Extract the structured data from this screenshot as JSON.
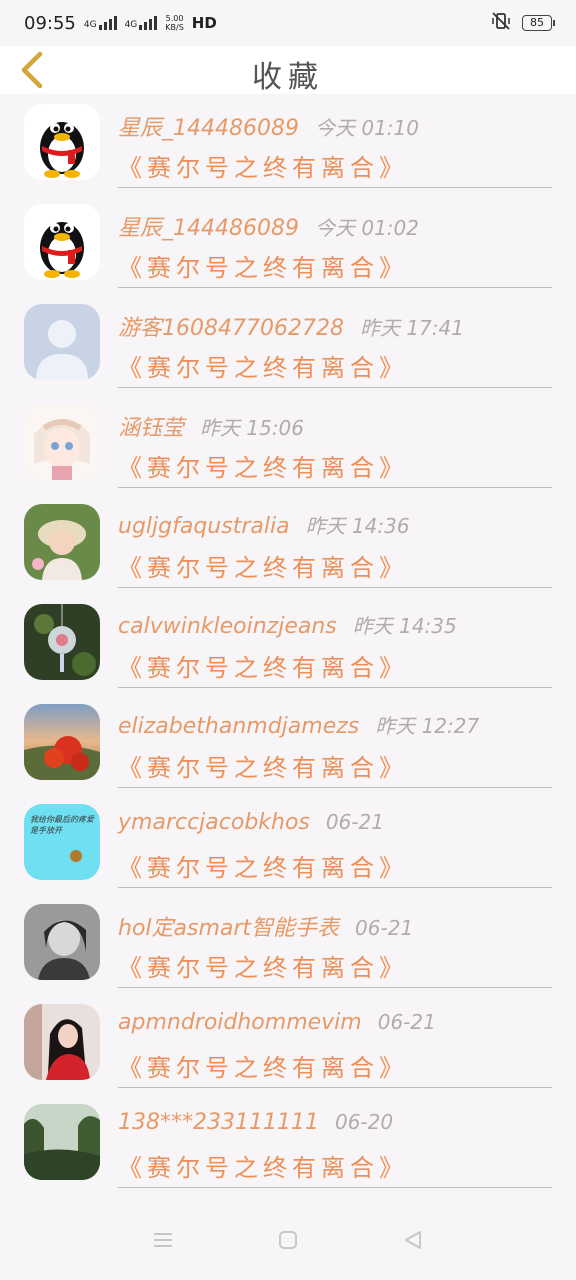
{
  "status_bar": {
    "time": "09:55",
    "net1": "4G",
    "net2": "4G",
    "speed_value": "5.00",
    "speed_unit": "KB/S",
    "hd": "HD",
    "battery": "85"
  },
  "header": {
    "title": "收藏"
  },
  "items": [
    {
      "name": "星辰_144486089",
      "time": "今天 01:10",
      "title": "《赛尔号之终有离合》"
    },
    {
      "name": "星辰_144486089",
      "time": "今天 01:02",
      "title": "《赛尔号之终有离合》"
    },
    {
      "name": "游客1608477062728",
      "time": "昨天 17:41",
      "title": "《赛尔号之终有离合》"
    },
    {
      "name": "涵钰莹",
      "time": "昨天 15:06",
      "title": "《赛尔号之终有离合》"
    },
    {
      "name": "ugljgfaqustralia",
      "time": "昨天 14:36",
      "title": "《赛尔号之终有离合》"
    },
    {
      "name": "calvwinkleoinzjeans",
      "time": "昨天 14:35",
      "title": "《赛尔号之终有离合》"
    },
    {
      "name": "elizabethanmdjamezs",
      "time": "昨天 12:27",
      "title": "《赛尔号之终有离合》"
    },
    {
      "name": "ymarccjacobkhos",
      "time": "06-21",
      "title": "《赛尔号之终有离合》"
    },
    {
      "name": "hol定asmart智能手表",
      "time": "06-21",
      "title": "《赛尔号之终有离合》"
    },
    {
      "name": "apmndroidhommevim",
      "time": "06-21",
      "title": "《赛尔号之终有离合》"
    },
    {
      "name": "138***233111111",
      "time": "06-20",
      "title": "《赛尔号之终有离合》"
    }
  ],
  "avatar_8_text": "我给你最后的疼爱是手放开",
  "colors": {
    "accent": "#ee8f57",
    "back_arrow": "#d4a53a",
    "time_gray": "#b0acae",
    "background": "#f7f5f7"
  }
}
